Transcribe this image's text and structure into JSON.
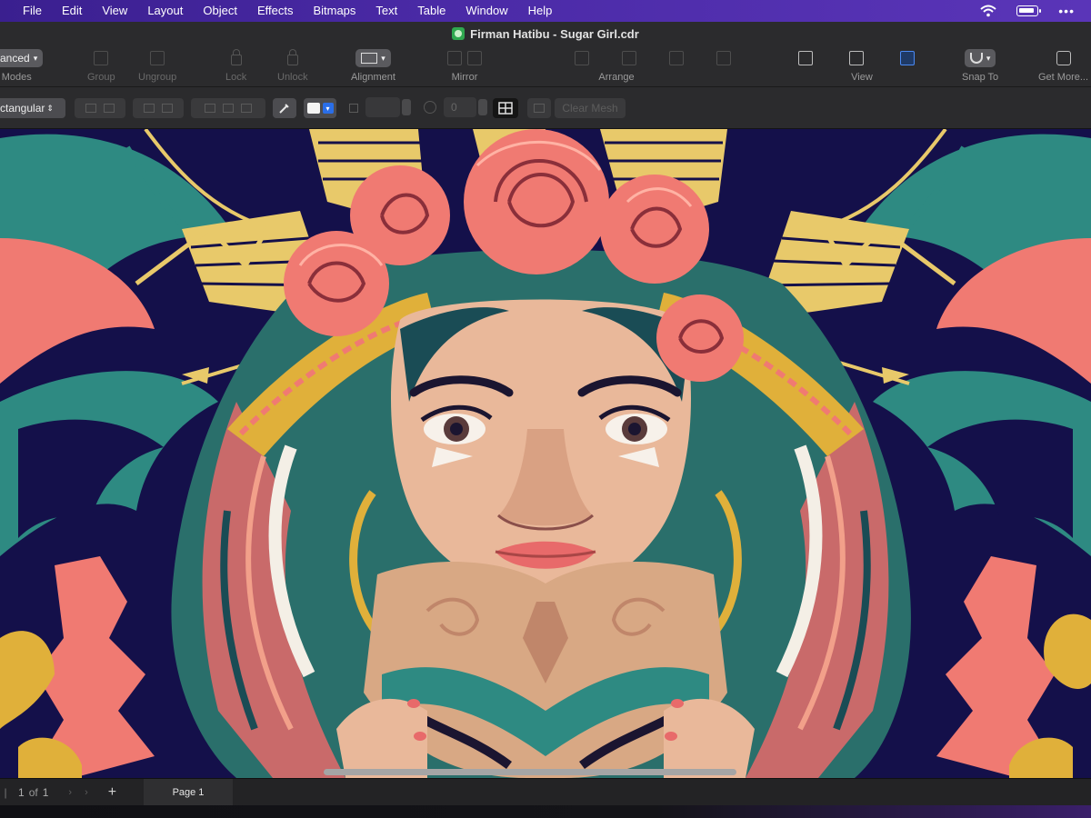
{
  "menubar": {
    "items": [
      "File",
      "Edit",
      "View",
      "Layout",
      "Object",
      "Effects",
      "Bitmaps",
      "Text",
      "Table",
      "Window",
      "Help"
    ],
    "status_icons": [
      "wifi-icon",
      "battery-icon",
      "more-icon"
    ],
    "more_glyph": "•••",
    "color": "#4a2aa6"
  },
  "window": {
    "title": "Firman Hatibu -  Sugar Girl.cdr",
    "app_icon": "coreldraw-icon"
  },
  "toolbar": {
    "modes_select": "anced",
    "modes_label": "n Modes",
    "group_label": "Group",
    "ungroup_label": "Ungroup",
    "lock_label": "Lock",
    "unlock_label": "Unlock",
    "alignment_label": "Alignment",
    "mirror_label": "Mirror",
    "arrange_label": "Arrange",
    "view_label": "View",
    "snap_label": "Snap To",
    "getmore_label": "Get More..."
  },
  "propertybar": {
    "shape_select": "ctangular",
    "value_field": "0",
    "clear_mesh_label": "Clear Mesh"
  },
  "pages": {
    "current": "1",
    "of_label": "of",
    "total": "1",
    "tab_label": "Page 1",
    "add_glyph": "+",
    "first_glyph": "|",
    "arrow_glyph": "›"
  },
  "colors": {
    "navy": "#14104a",
    "teal": "#2e8a82",
    "coral": "#f07a72",
    "gold": "#e8c96a",
    "skin": "#e9b89a",
    "accent_blue": "#4a8af4"
  }
}
